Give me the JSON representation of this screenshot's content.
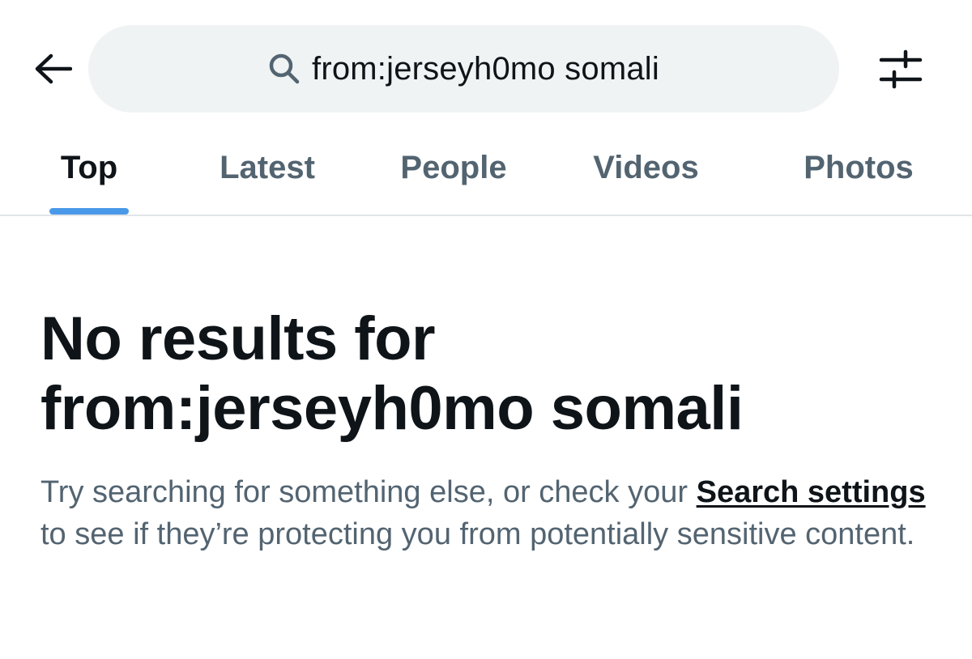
{
  "header": {
    "back_icon": "arrow-left-icon",
    "search": {
      "icon": "search-icon",
      "query": "from:jerseyh0mo somali"
    },
    "filter_icon": "sliders-icon"
  },
  "tabs": [
    {
      "label": "Top",
      "active": true
    },
    {
      "label": "Latest",
      "active": false
    },
    {
      "label": "People",
      "active": false
    },
    {
      "label": "Videos",
      "active": false
    },
    {
      "label": "Photos",
      "active": false
    }
  ],
  "empty_state": {
    "title_line1": "No results for",
    "title_line2": "from:jerseyh0mo somali",
    "message_before": "Try searching for something else, or check your ",
    "link_label": "Search settings",
    "message_after": " to see if they’re protecting you from potentially sensitive content."
  },
  "colors": {
    "accent": "#1d9bf0",
    "indicator": "#4a99e9",
    "primary_text": "#0f1419",
    "secondary_text": "#536471",
    "search_bg": "#eff3f4",
    "divider": "#e1e5e8"
  }
}
